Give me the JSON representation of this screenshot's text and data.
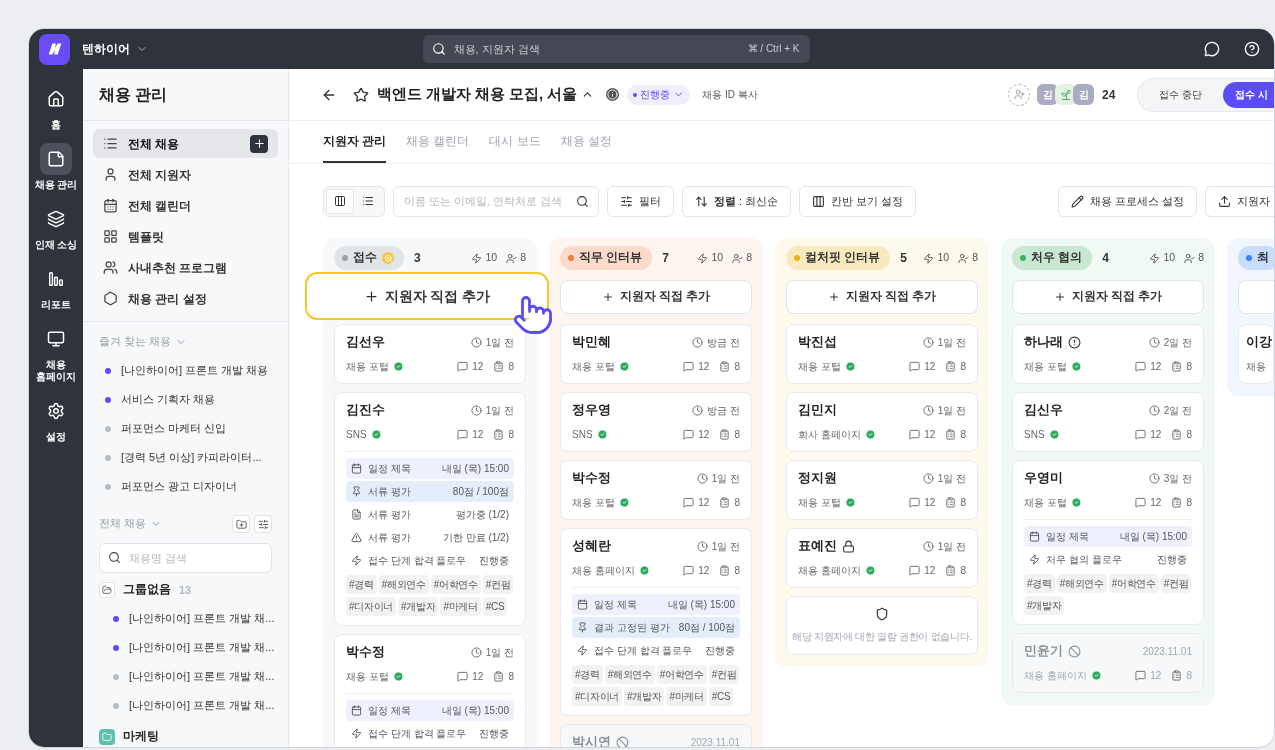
{
  "app": {
    "name": "텐하이어",
    "search": {
      "placeholder": "채용, 지원자 검색",
      "shortcut": "⌘ / Ctrl + K"
    }
  },
  "rail": [
    {
      "label": "홈",
      "selected": false
    },
    {
      "label": "채용 관리",
      "selected": true
    },
    {
      "label": "인재 소싱",
      "selected": false
    },
    {
      "label": "리포트",
      "selected": false
    },
    {
      "label": "채용 홈페이지",
      "selected": false
    },
    {
      "label": "설정",
      "selected": false
    }
  ],
  "sidebar": {
    "title": "채용 관리",
    "nav": [
      {
        "label": "전체 채용",
        "selected": true,
        "add": true
      },
      {
        "label": "전체 지원자",
        "selected": false,
        "add": false
      },
      {
        "label": "전체 캘린더",
        "selected": false,
        "add": false
      },
      {
        "label": "템플릿",
        "selected": false,
        "add": false
      },
      {
        "label": "사내추천 프로그램",
        "selected": false,
        "add": false
      },
      {
        "label": "채용 관리 설정",
        "selected": false,
        "add": false
      }
    ],
    "favorites": {
      "title": "즐겨 찾는 채용",
      "items": [
        {
          "label": "[나인하이어] 프론트 개발 채용",
          "color": "#5b4cf5"
        },
        {
          "label": "서비스 기획자 채용",
          "color": "#5b4cf5"
        },
        {
          "label": "퍼포먼스 마케터 신입",
          "color": "#b8bcc4"
        },
        {
          "label": "[경력 5년 이상] 카피라이터...",
          "color": "#b8bcc4"
        },
        {
          "label": "퍼포먼스 광고 디자이너",
          "color": "#b8bcc4"
        }
      ]
    },
    "all_jobs": {
      "title": "전체 채용",
      "search_placeholder": "채용명 검색",
      "groups": [
        {
          "name": "그룹없음",
          "count": "13",
          "items": [
            {
              "label": "[나인하이어] 프론트 개발 채...",
              "color": "#5b4cf5"
            },
            {
              "label": "[나인하이어] 프론트 개발 채...",
              "color": "#5b4cf5"
            },
            {
              "label": "[나인하이어] 프론트 개발 채...",
              "color": "#b8bcc4"
            },
            {
              "label": "[나인하이어] 프론트 개발 채...",
              "color": "#b8bcc4"
            }
          ]
        },
        {
          "name": "마케팅",
          "color": "#5fc0ad"
        }
      ]
    }
  },
  "header": {
    "title": "백엔드 개발자 채용 모집, 서울",
    "status": "진행중",
    "copy_id": "채용 ID 복사",
    "members": [
      {
        "kind": "letter",
        "initial": "김"
      },
      {
        "kind": "sprout"
      },
      {
        "kind": "letter",
        "initial": "김"
      }
    ],
    "member_count": "24",
    "buttons": [
      {
        "label": "접수 중단",
        "primary": false
      },
      {
        "label": "접수 시",
        "primary": true
      }
    ]
  },
  "tabs": [
    {
      "label": "지원자 관리",
      "selected": true
    },
    {
      "label": "채용 캘린더",
      "selected": false
    },
    {
      "label": "대시 보드",
      "selected": false
    },
    {
      "label": "채용 설정",
      "selected": false
    }
  ],
  "toolbar": {
    "views": [
      {
        "selected": true
      },
      {
        "selected": false
      }
    ],
    "search_placeholder": "이름 또는 이메일, 연락처로 검색",
    "buttons": [
      "필터",
      "**정렬** : 최신순",
      "칸반 보기 설정"
    ],
    "right_buttons": [
      "채용 프로세스 설정",
      "지원자"
    ]
  },
  "columns": [
    {
      "name": "접수",
      "color": "#9ca3af",
      "flagged": true,
      "count": "3",
      "actions": "10",
      "people": "8",
      "add_label": "지원자 직접 추가",
      "highlighted": true,
      "cards": [
        {
          "kind": "applicant",
          "name": "김선우",
          "time": "1일 전",
          "source": "채용 포털",
          "verified": true,
          "comments": "12",
          "docs": "8"
        },
        {
          "kind": "applicant",
          "name": "김진수",
          "time": "1일 전",
          "source": "SNS",
          "verified": true,
          "comments": "12",
          "docs": "8",
          "details": [
            {
              "kind": "schedule",
              "label": "일정 제목",
              "value": "내일 (목) 15:00"
            },
            {
              "kind": "score",
              "label": "서류 평가",
              "value": "80점 / 100점"
            },
            {
              "kind": "document",
              "label": "서류 평가",
              "value": "평가중 (1/2)"
            },
            {
              "kind": "warning",
              "label": "서류 평가",
              "value": "기한 만료 (1/2)"
            },
            {
              "kind": "flow",
              "label": "접수 단계 합격 플로우",
              "value": "진행중"
            }
          ],
          "tags": [
            "#경력",
            "#해외연수",
            "#어학연수",
            "#컨펌",
            "#디자이너",
            "#개발자",
            "#마케터",
            "#CS"
          ]
        },
        {
          "kind": "applicant",
          "name": "박수정",
          "time": "1일 전",
          "source": "채용 포털",
          "verified": true,
          "comments": "12",
          "docs": "8",
          "details": [
            {
              "kind": "schedule",
              "label": "일정 제목",
              "value": "내일 (목) 15:00"
            },
            {
              "kind": "flow",
              "label": "접수 단계 합격 플로우",
              "value": "진행중"
            }
          ]
        }
      ]
    },
    {
      "name": "직무 인터뷰",
      "color": "#f07a3f",
      "flagged": false,
      "count": "7",
      "actions": "10",
      "people": "8",
      "add_label": "지원자 직접 추가",
      "highlighted": false,
      "cards": [
        {
          "kind": "applicant",
          "name": "박민혜",
          "time": "방금 전",
          "source": "채용 포털",
          "verified": true,
          "comments": "12",
          "docs": "8"
        },
        {
          "kind": "applicant",
          "name": "정우영",
          "time": "방금 전",
          "source": "SNS",
          "verified": true,
          "comments": "12",
          "docs": "8"
        },
        {
          "kind": "applicant",
          "name": "박수정",
          "time": "1일 전",
          "source": "채용 포털",
          "verified": true,
          "comments": "12",
          "docs": "8"
        },
        {
          "kind": "applicant",
          "name": "성혜란",
          "time": "1일 전",
          "source": "채용 홈페이지",
          "verified": true,
          "comments": "12",
          "docs": "8",
          "details": [
            {
              "kind": "schedule",
              "label": "일정 제목",
              "value": "내일 (목) 15:00"
            },
            {
              "kind": "score",
              "label": "결과 고정된 평가",
              "value": "80점 / 100점"
            },
            {
              "kind": "flow",
              "label": "접수 단계 합격 플로우",
              "value": "진행중"
            }
          ],
          "tags": [
            "#경력",
            "#해외연수",
            "#어학연수",
            "#컨펌",
            "#디자이너",
            "#개발자",
            "#마케터",
            "#CS"
          ]
        },
        {
          "kind": "applicant",
          "name": "박시연",
          "disabled": true,
          "time": "2023.11.01"
        }
      ]
    },
    {
      "name": "컬처핏 인터뷰",
      "color": "#e9b21a",
      "flagged": false,
      "count": "5",
      "actions": "10",
      "people": "8",
      "add_label": "지원자 직접 추가",
      "highlighted": false,
      "cards": [
        {
          "kind": "applicant",
          "name": "박진섭",
          "time": "1일 전",
          "source": "채용 포털",
          "verified": true,
          "comments": "12",
          "docs": "8"
        },
        {
          "kind": "applicant",
          "name": "김민지",
          "time": "1일 전",
          "source": "회사 홈페이지",
          "verified": true,
          "comments": "12",
          "docs": "8"
        },
        {
          "kind": "applicant",
          "name": "정지원",
          "time": "1일 전",
          "source": "채용 포털",
          "verified": true,
          "comments": "12",
          "docs": "8"
        },
        {
          "kind": "applicant",
          "name": "표예진",
          "locked": true,
          "time": "1일 전",
          "source": "채용 홈페이지",
          "verified": true,
          "comments": "12",
          "docs": "8"
        },
        {
          "kind": "restricted",
          "message": "해당 지원자에 대한 열람 권한이 없습니다."
        }
      ]
    },
    {
      "name": "처우 협의",
      "color": "#3fae64",
      "flagged": false,
      "count": "4",
      "actions": "10",
      "people": "8",
      "add_label": "지원자 직접 추가",
      "highlighted": false,
      "cards": [
        {
          "kind": "applicant",
          "name": "하나래",
          "attention": true,
          "time": "2일 전",
          "source": "채용 포털",
          "verified": true,
          "comments": "12",
          "docs": "8"
        },
        {
          "kind": "applicant",
          "name": "김신우",
          "time": "2일 전",
          "source": "SNS",
          "verified": true,
          "comments": "12",
          "docs": "8"
        },
        {
          "kind": "applicant",
          "name": "우영미",
          "time": "3일 전",
          "source": "채용 포털",
          "verified": true,
          "comments": "12",
          "docs": "8",
          "details": [
            {
              "kind": "schedule",
              "label": "일정 제목",
              "value": "내일 (목) 15:00"
            },
            {
              "kind": "flow",
              "label": "처우 협의 플로우",
              "value": "진행중"
            }
          ],
          "tags": [
            "#경력",
            "#해외연수",
            "#어학연수",
            "#컨펌",
            "#개발자"
          ]
        },
        {
          "kind": "applicant",
          "name": "민윤기",
          "disabled": true,
          "time": "2023.11.01",
          "source": "채용 홈페이지",
          "verified": true,
          "comments": "12",
          "docs": "8"
        }
      ]
    },
    {
      "name": "최",
      "color": "#3b82f6",
      "flagged": false,
      "highlighted": false,
      "cards": [
        {
          "kind": "applicant",
          "name": "이강",
          "source": "채용"
        }
      ]
    }
  ]
}
